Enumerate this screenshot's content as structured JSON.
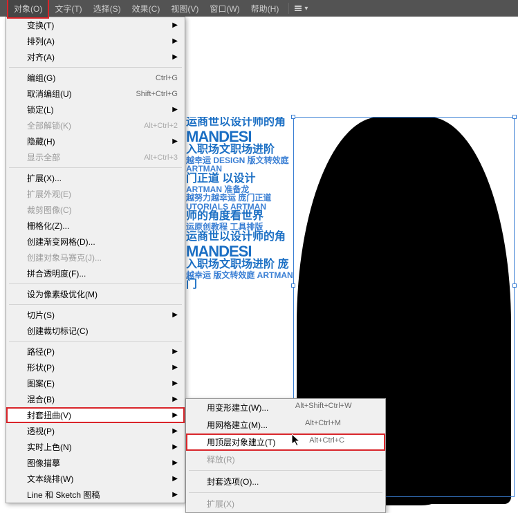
{
  "menubar": {
    "items": [
      "对象(O)",
      "文字(T)",
      "选择(S)",
      "效果(C)",
      "视图(V)",
      "窗口(W)",
      "帮助(H)"
    ],
    "active_index": 0
  },
  "dropdown": [
    {
      "label": "变换(T)",
      "arrow": true
    },
    {
      "label": "排列(A)",
      "arrow": true
    },
    {
      "label": "对齐(A)",
      "arrow": true
    },
    {
      "sep": true
    },
    {
      "label": "编组(G)",
      "shortcut": "Ctrl+G"
    },
    {
      "label": "取消编组(U)",
      "shortcut": "Shift+Ctrl+G"
    },
    {
      "label": "锁定(L)",
      "arrow": true
    },
    {
      "label": "全部解锁(K)",
      "shortcut": "Alt+Ctrl+2",
      "disabled": true
    },
    {
      "label": "隐藏(H)",
      "arrow": true
    },
    {
      "label": "显示全部",
      "shortcut": "Alt+Ctrl+3",
      "disabled": true
    },
    {
      "sep": true
    },
    {
      "label": "扩展(X)..."
    },
    {
      "label": "扩展外观(E)",
      "disabled": true
    },
    {
      "label": "裁剪图像(C)",
      "disabled": true
    },
    {
      "label": "栅格化(Z)..."
    },
    {
      "label": "创建渐变网格(D)..."
    },
    {
      "label": "创建对象马赛克(J)...",
      "disabled": true
    },
    {
      "label": "拼合透明度(F)..."
    },
    {
      "sep": true
    },
    {
      "label": "设为像素级优化(M)"
    },
    {
      "sep": true
    },
    {
      "label": "切片(S)",
      "arrow": true
    },
    {
      "label": "创建裁切标记(C)"
    },
    {
      "sep": true
    },
    {
      "label": "路径(P)",
      "arrow": true
    },
    {
      "label": "形状(P)",
      "arrow": true
    },
    {
      "label": "图案(E)",
      "arrow": true
    },
    {
      "label": "混合(B)",
      "arrow": true
    },
    {
      "label": "封套扭曲(V)",
      "arrow": true,
      "highlighted": true
    },
    {
      "label": "透视(P)",
      "arrow": true
    },
    {
      "label": "实时上色(N)",
      "arrow": true
    },
    {
      "label": "图像描摹",
      "arrow": true
    },
    {
      "label": "文本绕排(W)",
      "arrow": true
    },
    {
      "label": "Line 和 Sketch 图稿",
      "arrow": true
    }
  ],
  "submenu": [
    {
      "label": "用变形建立(W)...",
      "shortcut": "Alt+Shift+Ctrl+W"
    },
    {
      "label": "用网格建立(M)...",
      "shortcut": "Alt+Ctrl+M"
    },
    {
      "label": "用顶层对象建立(T)",
      "shortcut": "Alt+Ctrl+C",
      "highlighted": true
    },
    {
      "label": "释放(R)",
      "disabled": true
    },
    {
      "sep": true
    },
    {
      "label": "封套选项(O)..."
    },
    {
      "sep": true
    },
    {
      "label": "扩展(X)",
      "disabled": true
    }
  ],
  "textart": {
    "lines": [
      {
        "cls": "med",
        "t": "运商世以设计师的角"
      },
      {
        "cls": "big",
        "t": "MANDESI"
      },
      {
        "cls": "med",
        "t": "入职场文职场进阶"
      },
      {
        "cls": "sm",
        "t": "越幸运 DESIGN 版文转效庭 ARTMAN"
      },
      {
        "cls": "med",
        "t": "门正道 以设计"
      },
      {
        "cls": "sm",
        "t": "ARTMAN 准备龙"
      },
      {
        "cls": "sm",
        "t": "越努力越幸运 庞门正道"
      },
      {
        "cls": "sm",
        "t": "UTORIALS ARTMAN"
      },
      {
        "cls": "med",
        "t": "师的角度看世界"
      },
      {
        "cls": "sm",
        "t": "运原创教程 工具排版"
      },
      {
        "cls": "med",
        "t": "运商世以设计师的角"
      },
      {
        "cls": "big",
        "t": "MANDESI"
      },
      {
        "cls": "med",
        "t": "入职场文职场进阶 庞"
      },
      {
        "cls": "sm",
        "t": "越幸运 版文转效庭 ARTMAN"
      },
      {
        "cls": "med",
        "t": "门"
      }
    ]
  }
}
